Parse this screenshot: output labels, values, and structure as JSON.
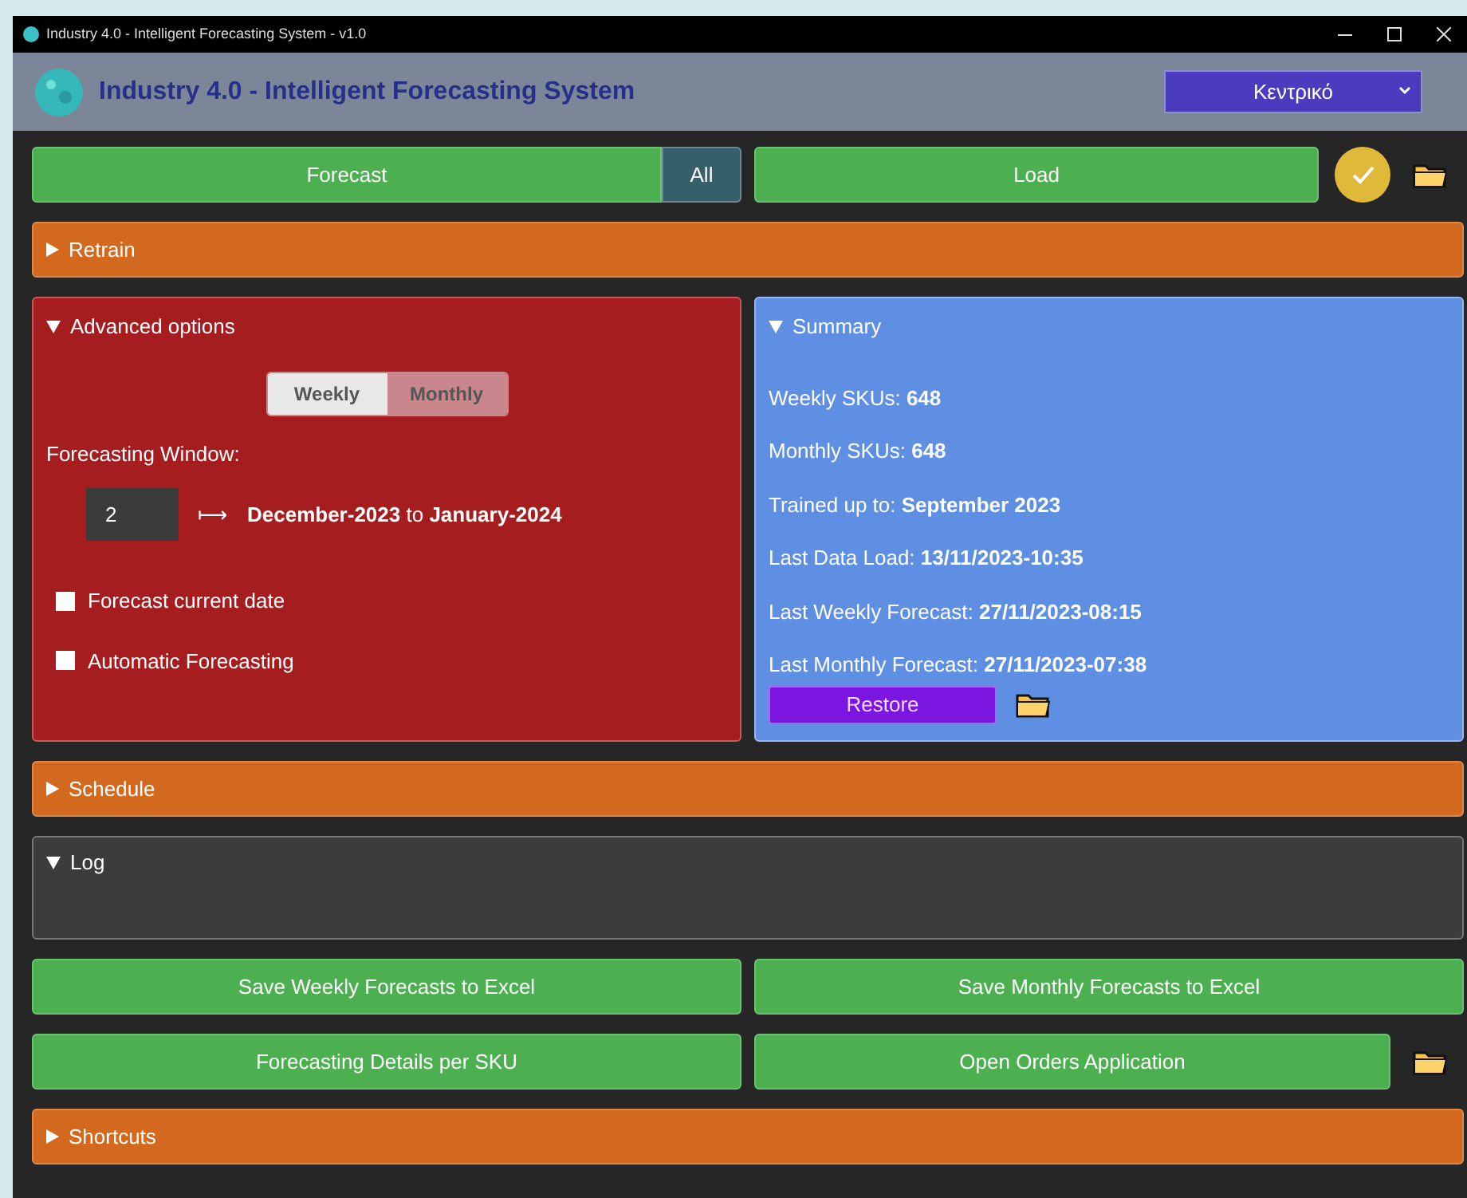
{
  "window": {
    "title": "Industry 4.0 - Intelligent Forecasting System - v1.0"
  },
  "header": {
    "title": "Industry 4.0 - Intelligent Forecasting System",
    "site_select": "Κεντρικό"
  },
  "actions": {
    "forecast": "Forecast",
    "scope": "All",
    "load": "Load"
  },
  "retrain": {
    "title": "Retrain",
    "expanded": false
  },
  "advanced": {
    "title": "Advanced options",
    "expanded": true,
    "frequency": [
      {
        "label": "Weekly",
        "selected": false
      },
      {
        "label": "Monthly",
        "selected": true
      }
    ],
    "window_label": "Forecasting Window:",
    "window_value": "2",
    "arrow": "⟼",
    "range": "**December-2023** to **January-2024**",
    "options": [
      {
        "label": "Forecast current date",
        "checked": false
      },
      {
        "label": "Automatic Forecasting",
        "checked": false
      }
    ]
  },
  "summary": {
    "title": "Summary",
    "expanded": true,
    "lines": [
      "Weekly SKUs: **648**",
      "Monthly SKUs: **648**",
      "Trained up to: **September 2023**",
      "Last Data Load: **13/11/2023-10:35**",
      "Last Weekly Forecast: **27/11/2023-08:15**",
      "Last Monthly Forecast: **27/11/2023-07:38**"
    ],
    "restore": "Restore"
  },
  "schedule": {
    "title": "Schedule",
    "expanded": false
  },
  "log": {
    "title": "Log",
    "expanded": true
  },
  "exports": [
    "Save Weekly Forecasts to Excel",
    "Save Monthly Forecasts to Excel"
  ],
  "tools": [
    "Forecasting Details per SKU",
    "Open Orders Application"
  ],
  "shortcuts": {
    "title": "Shortcuts",
    "expanded": false
  }
}
